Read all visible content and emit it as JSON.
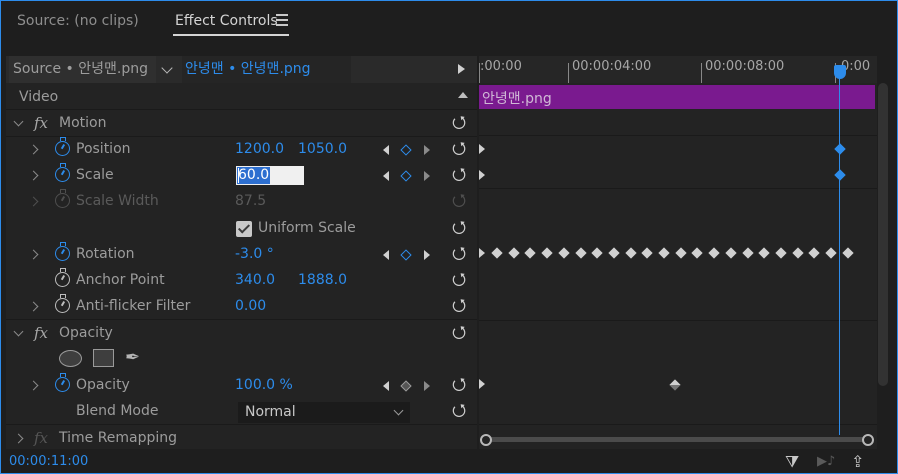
{
  "tabs": {
    "source": "Source: (no clips)",
    "effect_controls": "Effect Controls"
  },
  "header": {
    "source": "Source • 안녕맨.png",
    "clip": "안녕맨 • 안녕맨.png"
  },
  "timeline": {
    "ticks": [
      ":00:00",
      "00:00:04:00",
      "00:00:08:00",
      "0:00"
    ],
    "clip_name": "안녕맨.png"
  },
  "props": {
    "video_label": "Video",
    "motion_label": "Motion",
    "position_label": "Position",
    "position_x": "1200.0",
    "position_y": "1050.0",
    "scale_label": "Scale",
    "scale_value": "60.0",
    "scale_width_label": "Scale Width",
    "scale_width_value": "87.5",
    "uniform_scale_label": "Uniform Scale",
    "rotation_label": "Rotation",
    "rotation_value": "-3.0 °",
    "anchor_label": "Anchor Point",
    "anchor_x": "340.0",
    "anchor_y": "1888.0",
    "antiflicker_label": "Anti-flicker Filter",
    "antiflicker_value": "0.00",
    "opacity_group_label": "Opacity",
    "opacity_label": "Opacity",
    "opacity_value": "100.0 %",
    "blend_label": "Blend Mode",
    "blend_value": "Normal",
    "time_remap_label": "Time Remapping"
  },
  "icons": {
    "fx": "fx",
    "reset": "⭯",
    "pen": "✒",
    "filter": "⧩",
    "play_audio": "▶♪",
    "export": "⇪"
  },
  "footer": {
    "timecode": "00:00:11:00"
  },
  "colors": {
    "accent": "#2d8ceb",
    "clip": "#7a1a8f",
    "background": "#1e1e1e"
  }
}
